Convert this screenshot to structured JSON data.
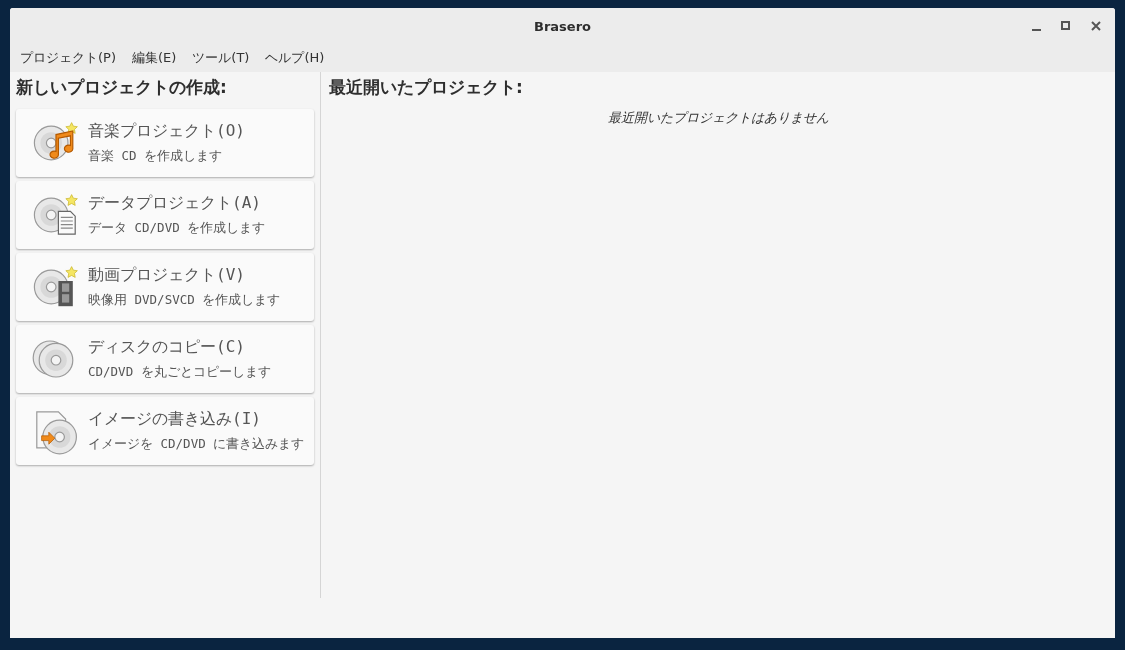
{
  "window": {
    "title": "Brasero"
  },
  "menu": [
    "プロジェクト(P)",
    "編集(E)",
    "ツール(T)",
    "ヘルプ(H)"
  ],
  "new_project": {
    "heading": "新しいプロジェクトの作成:",
    "items": [
      {
        "kind": "audio",
        "title": "音楽プロジェクト(O)",
        "description": "音楽 CD を作成します"
      },
      {
        "kind": "data",
        "title": "データプロジェクト(A)",
        "description": "データ CD/DVD を作成します"
      },
      {
        "kind": "video",
        "title": "動画プロジェクト(V)",
        "description": "映像用 DVD/SVCD を作成します"
      },
      {
        "kind": "copy",
        "title": "ディスクのコピー(C)",
        "description": "CD/DVD を丸ごとコピーします"
      },
      {
        "kind": "image",
        "title": "イメージの書き込み(I)",
        "description": "イメージを CD/DVD に書き込みます"
      }
    ]
  },
  "recent": {
    "heading": "最近開いたプロジェクト:",
    "empty_message": "最近開いたプロジェクトはありません"
  }
}
